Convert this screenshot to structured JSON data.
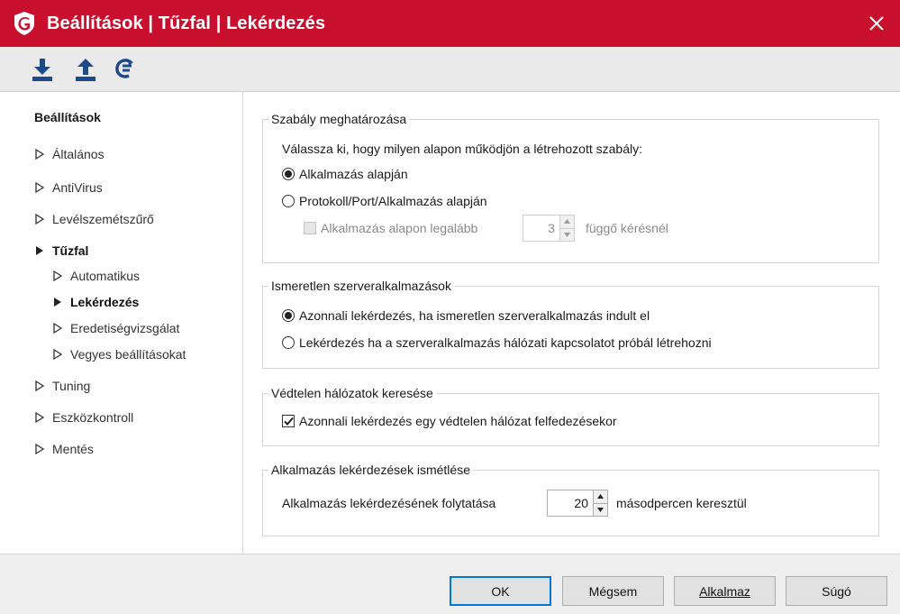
{
  "window": {
    "title": "Beállítások | Tűzfal | Lekérdezés",
    "accent_color": "#c8102e",
    "logo_icon": "gdata-shield-icon",
    "close_icon": "close-icon"
  },
  "toolbar": {
    "icons": [
      "download-icon",
      "upload-icon",
      "reset-icon"
    ]
  },
  "sidebar": {
    "title": "Beállítások",
    "items": [
      {
        "label": "Általános"
      },
      {
        "label": "AntiVirus"
      },
      {
        "label": "Levélszemétszűrő"
      },
      {
        "label": "Tűzfal",
        "expanded": true
      },
      {
        "label": "Automatikus"
      },
      {
        "label": "Lekérdezés",
        "selected": true
      },
      {
        "label": "Eredetiségvizsgálat"
      },
      {
        "label": "Vegyes beállításokat"
      },
      {
        "label": "Tuning"
      },
      {
        "label": "Eszközkontroll"
      },
      {
        "label": "Mentés"
      }
    ]
  },
  "rule_definition": {
    "legend": "Szabály meghatározása",
    "prompt": "Válassza ki, hogy milyen alapon működjön a létrehozott szabály:",
    "option_app": "Alkalmazás alapján",
    "option_protocol": "Protokoll/Port/Alkalmazás alapján",
    "selected": "app",
    "min_label": "Alkalmazás alapon legalább",
    "min_value": "3",
    "pending_label": "függő kérésnél"
  },
  "unknown_server": {
    "legend": "Ismeretlen szerveralkalmazások",
    "option_immediate": "Azonnali lekérdezés, ha ismeretlen szerveralkalmazás indult el",
    "option_on_connect": "Lekérdezés ha a szerveralkalmazás hálózati kapcsolatot próbál létrehozni",
    "selected": "immediate"
  },
  "unprotected_networks": {
    "legend": "Védtelen hálózatok keresése",
    "checkbox_label": "Azonnali lekérdezés egy védtelen hálózat felfedezésekor",
    "checked": true
  },
  "repeat": {
    "legend": "Alkalmazás lekérdezések ismétlése",
    "label": "Alkalmazás lekérdezésének folytatása",
    "value": "20",
    "unit": "másodpercen keresztül"
  },
  "footer": {
    "ok": "OK",
    "cancel": "Mégsem",
    "apply": "Alkalmaz",
    "help": "Súgó"
  }
}
